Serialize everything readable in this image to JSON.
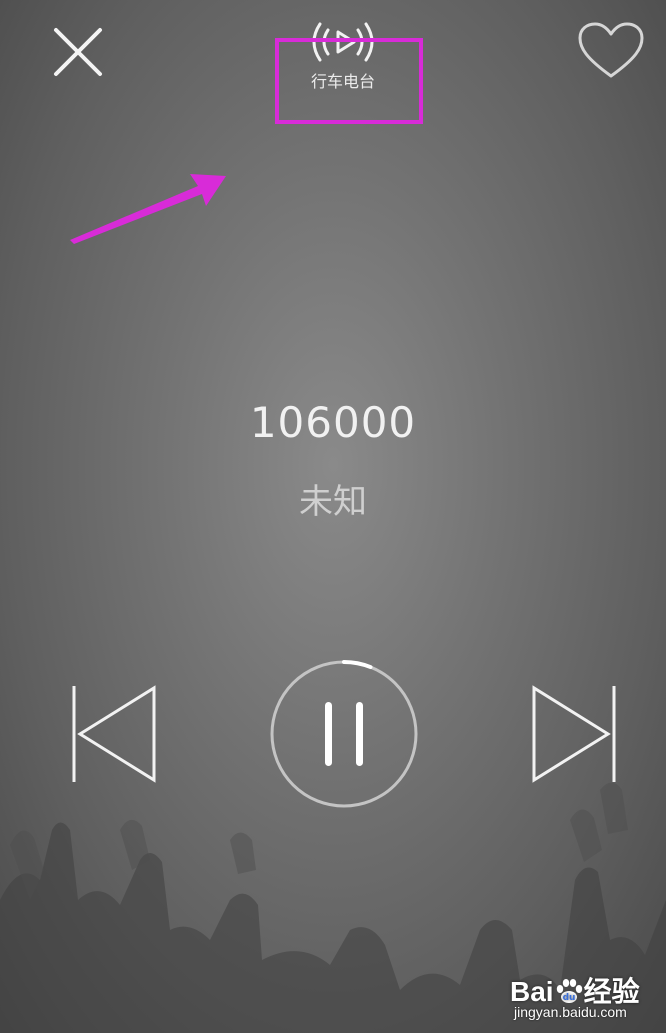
{
  "header": {
    "mode_label": "行车电台"
  },
  "station": {
    "frequency": "106000",
    "name": "未知"
  },
  "playback": {
    "state": "playing",
    "progress": 0.06
  },
  "annotation": {
    "color": "#d82bd8"
  },
  "watermark": {
    "brand": "Bai",
    "brand_suffix": "经验",
    "url": "jingyan.baidu.com"
  },
  "icons": {
    "close": "close-icon",
    "radio": "radio-broadcast-icon",
    "favorite": "heart-icon",
    "previous": "skip-previous-icon",
    "pause": "pause-icon",
    "next": "skip-next-icon"
  }
}
